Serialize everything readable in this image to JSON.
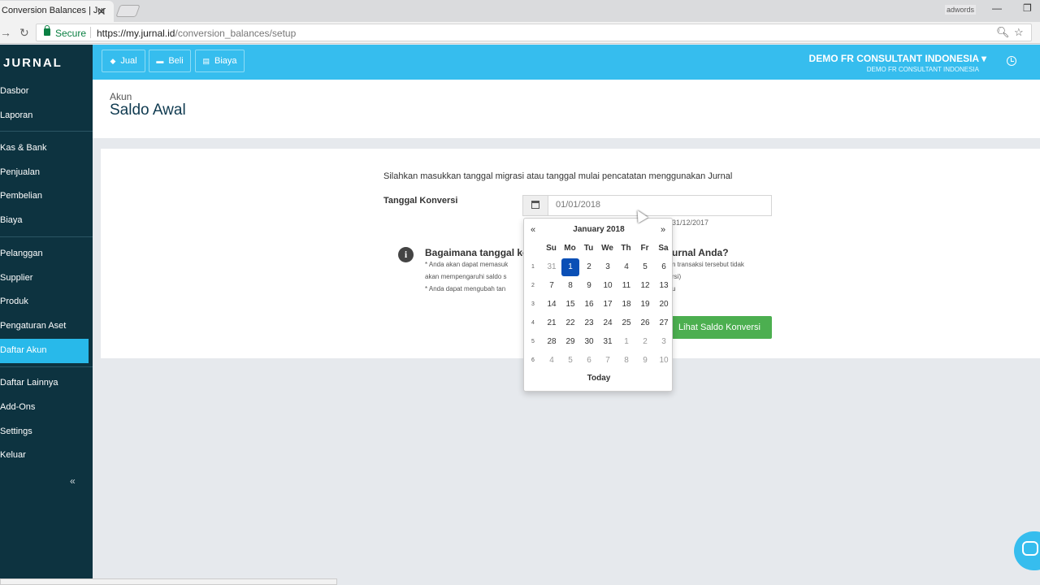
{
  "browser": {
    "tab_title": "Conversion Balances | Jur",
    "profile": "adwords",
    "secure_label": "Secure",
    "url_host": "https://my.jurnal.id",
    "url_path": "/conversion_balances/setup"
  },
  "sidebar": {
    "logo": "JURNAL",
    "items": [
      {
        "label": "Dasbor"
      },
      {
        "label": "Laporan"
      },
      {
        "label": "Kas & Bank"
      },
      {
        "label": "Penjualan"
      },
      {
        "label": "Pembelian"
      },
      {
        "label": "Biaya"
      },
      {
        "label": "Pelanggan"
      },
      {
        "label": "Supplier"
      },
      {
        "label": "Produk"
      },
      {
        "label": "Pengaturan Aset"
      },
      {
        "label": "Daftar Akun"
      },
      {
        "label": "Daftar Lainnya"
      },
      {
        "label": "Add-Ons"
      },
      {
        "label": "Settings"
      },
      {
        "label": "Keluar"
      }
    ],
    "active": "Daftar Akun",
    "collapse": "«"
  },
  "topbar": {
    "buttons": [
      {
        "label": "Jual"
      },
      {
        "label": "Beli"
      },
      {
        "label": "Biaya"
      }
    ],
    "company": "DEMO FR CONSULTANT INDONESIA ▾",
    "company_sub": "DEMO FR CONSULTANT INDONESIA"
  },
  "header": {
    "breadcrumb": "Akun",
    "title": "Saldo Awal"
  },
  "form": {
    "intro": "Silahkan masukkan tanggal migrasi atau tanggal mulai pencatatan menggunakan Jurnal",
    "label": "Tanggal Konversi",
    "date_value": "01/01/2018",
    "hint_date": "31/12/2017",
    "question_start": "Bagaimana tanggal kon",
    "question_end": "urnal Anda?",
    "note1_a": "* Anda akan dapat memasuk",
    "note1_b": "n transaksi tersebut tidak",
    "note2_a": "akan mempengaruhi saldo s",
    "note2_b": "rsi)",
    "note3_a": "* Anda dapat mengubah tan",
    "note3_b": "u",
    "submit": "Lihat Saldo Konversi"
  },
  "datepicker": {
    "prev": "«",
    "next": "»",
    "month": "January 2018",
    "weekdays": [
      "Su",
      "Mo",
      "Tu",
      "We",
      "Th",
      "Fr",
      "Sa"
    ],
    "weeks": [
      {
        "no": "1",
        "days": [
          "31",
          "1",
          "2",
          "3",
          "4",
          "5",
          "6"
        ]
      },
      {
        "no": "2",
        "days": [
          "7",
          "8",
          "9",
          "10",
          "11",
          "12",
          "13"
        ]
      },
      {
        "no": "3",
        "days": [
          "14",
          "15",
          "16",
          "17",
          "18",
          "19",
          "20"
        ]
      },
      {
        "no": "4",
        "days": [
          "21",
          "22",
          "23",
          "24",
          "25",
          "26",
          "27"
        ]
      },
      {
        "no": "5",
        "days": [
          "28",
          "29",
          "30",
          "31",
          "1",
          "2",
          "3"
        ]
      },
      {
        "no": "6",
        "days": [
          "4",
          "5",
          "6",
          "7",
          "8",
          "9",
          "10"
        ]
      }
    ],
    "selected": "1",
    "today": "Today"
  },
  "colors": {
    "sidebar": "#0d3340",
    "accent": "#36bdee",
    "active_item": "#28b9ea",
    "selected_day": "#0a4fb6",
    "button_green": "#4caf50"
  }
}
